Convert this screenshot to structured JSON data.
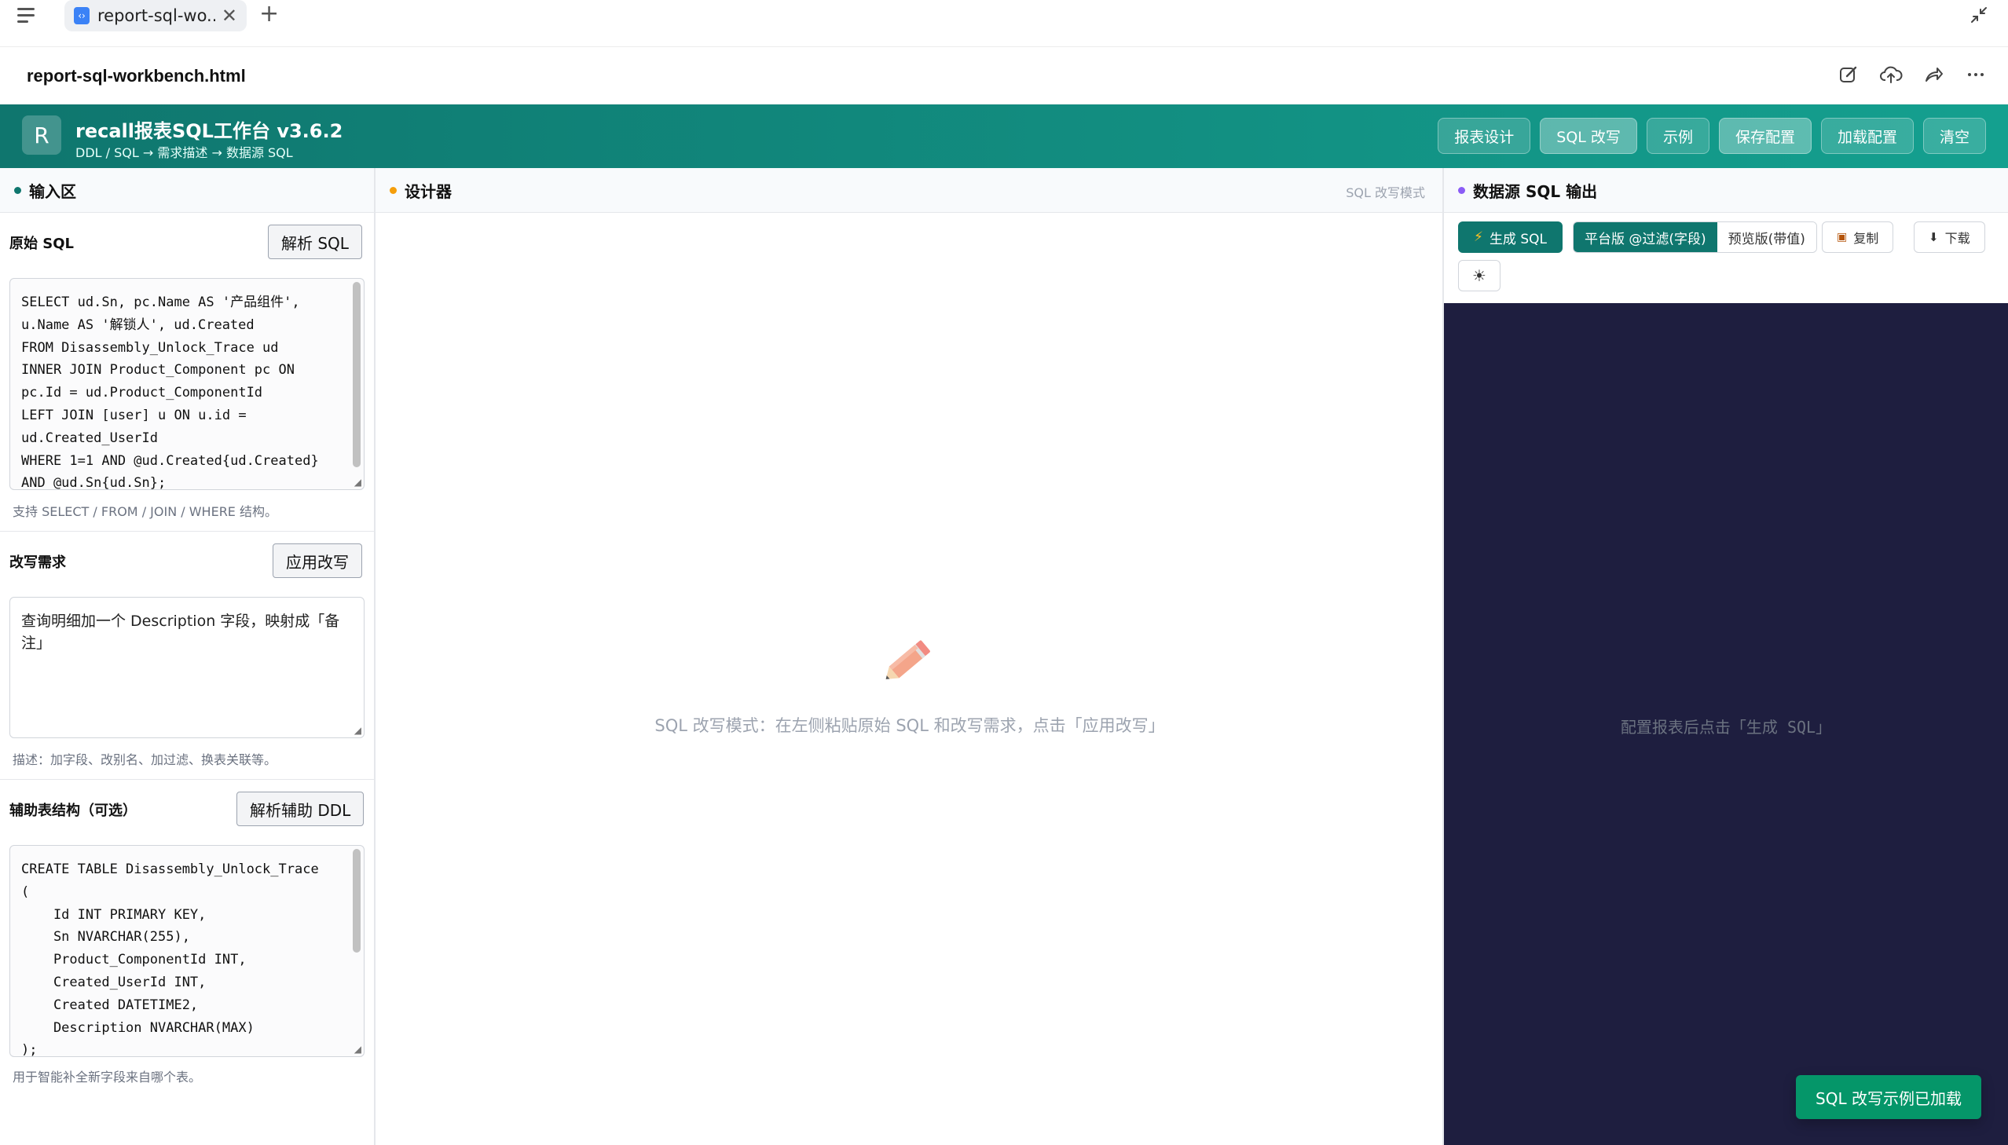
{
  "browser": {
    "tab_title": "report-sql-wo...",
    "tab_icon": "‹›",
    "new_tab": "+",
    "close_tab": "✕"
  },
  "document": {
    "title": "report-sql-workbench.html"
  },
  "app": {
    "logo_letter": "R",
    "title": "recall报表SQL工作台 v3.6.2",
    "subtitle": "DDL / SQL → 需求描述 → 数据源 SQL",
    "buttons": [
      {
        "label": "报表设计",
        "active": false
      },
      {
        "label": "SQL 改写",
        "active": true
      },
      {
        "label": "示例",
        "active": false
      },
      {
        "label": "保存配置",
        "active": true
      },
      {
        "label": "加载配置",
        "active": false
      },
      {
        "label": "清空",
        "active": false
      }
    ],
    "colors": {
      "header_start": "#0f766e",
      "header_end": "#14a08f",
      "output_bg": "#1e1e3f",
      "toast": "#059669"
    }
  },
  "input_panel": {
    "title": "输入区",
    "dot_color": "#0f766e",
    "original_sql": {
      "label": "原始 SQL",
      "button": "解析 SQL",
      "value": "SELECT ud.Sn, pc.Name AS '产品组件',\nu.Name AS '解锁人', ud.Created\nFROM Disassembly_Unlock_Trace ud\nINNER JOIN Product_Component pc ON\npc.Id = ud.Product_ComponentId\nLEFT JOIN [user] u ON u.id =\nud.Created_UserId\nWHERE 1=1 AND @ud.Created{ud.Created}\nAND @ud.Sn{ud.Sn};",
      "hint": "支持 SELECT / FROM / JOIN / WHERE 结构。"
    },
    "rewrite": {
      "label": "改写需求",
      "button": "应用改写",
      "value": "查询明细加一个 Description 字段，映射成「备注」",
      "hint": "描述：加字段、改别名、加过滤、换表关联等。"
    },
    "aux_ddl": {
      "label": "辅助表结构（可选）",
      "button": "解析辅助 DDL",
      "value": "CREATE TABLE Disassembly_Unlock_Trace\n(\n    Id INT PRIMARY KEY,\n    Sn NVARCHAR(255),\n    Product_ComponentId INT,\n    Created_UserId INT,\n    Created DATETIME2,\n    Description NVARCHAR(MAX)\n);",
      "hint": "用于智能补全新字段来自哪个表。"
    }
  },
  "designer_panel": {
    "title": "设计器",
    "dot_color": "#f59e0b",
    "mode": "SQL 改写模式",
    "empty_icon": "pencil-icon",
    "empty_text": "SQL 改写模式：在左侧粘贴原始 SQL 和改写需求，点击「应用改写」"
  },
  "output_panel": {
    "title": "数据源 SQL 输出",
    "dot_color": "#8b5cf6",
    "generate": "生成 SQL",
    "segment": {
      "platform": "平台版 @过滤(字段)",
      "preview": "预览版(带值)"
    },
    "copy": "复制",
    "download": "下载",
    "theme_icon": "☀",
    "placeholder": "配置报表后点击「生成 SQL」"
  },
  "toast": {
    "text": "SQL 改写示例已加载"
  }
}
